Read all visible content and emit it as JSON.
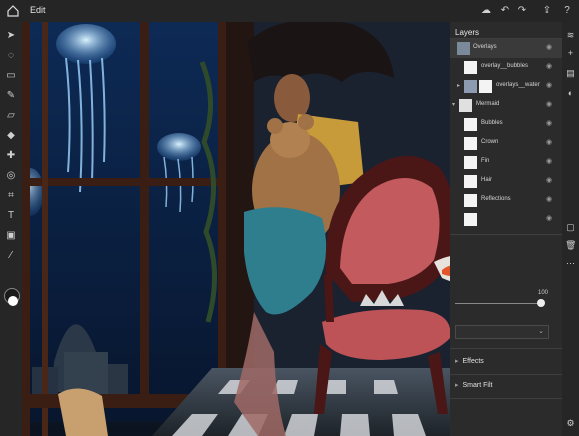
{
  "app": {
    "menu_label": "Edit"
  },
  "layers_panel": {
    "title": "Layers",
    "layers": [
      {
        "name": "Overlays",
        "indent": 0,
        "group": true
      },
      {
        "name": "overlay__bubbles",
        "indent": 1,
        "group": false
      },
      {
        "name": "overlays__water",
        "indent": 1,
        "group": false
      },
      {
        "name": "Mermaid",
        "indent": 0,
        "group": true
      },
      {
        "name": "Bubbles",
        "indent": 1,
        "group": false
      },
      {
        "name": "Crown",
        "indent": 1,
        "group": false
      },
      {
        "name": "Fin",
        "indent": 1,
        "group": false
      },
      {
        "name": "Hair",
        "indent": 1,
        "group": false
      },
      {
        "name": "Reflections",
        "indent": 1,
        "group": false
      }
    ],
    "opacity_value": "100",
    "opacity_fraction": 1.0,
    "sections": [
      {
        "label": "Effects"
      },
      {
        "label": "Smart Filt"
      }
    ]
  },
  "colors": {
    "accent": "#2680eb",
    "panel_bg": "#2b2b2b"
  }
}
